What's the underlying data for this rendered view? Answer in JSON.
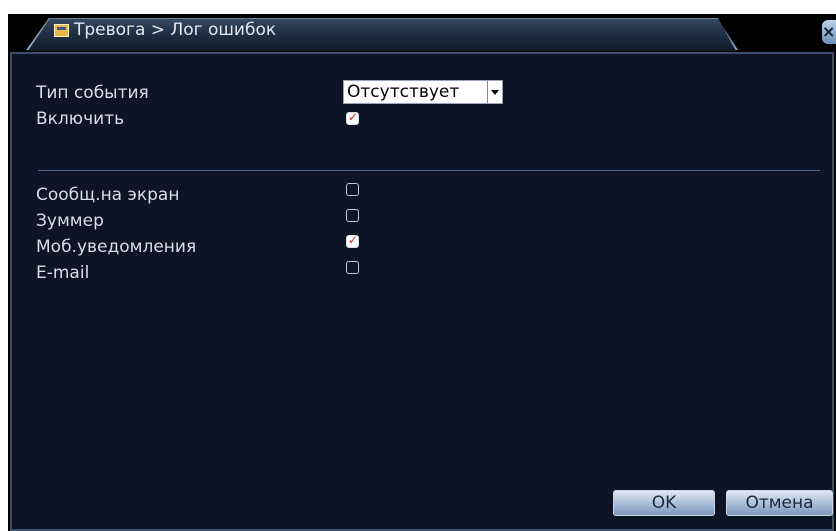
{
  "window": {
    "title": "Тревога > Лог ошибок",
    "close_symbol": "×"
  },
  "form": {
    "event_type_label": "Тип события",
    "event_type_value": "Отсутствует",
    "enable_label": "Включить",
    "enable_checked": true
  },
  "actions": [
    {
      "label": "Сообщ.на экран",
      "checked": false
    },
    {
      "label": "Зуммер",
      "checked": false
    },
    {
      "label": "Моб.уведомления",
      "checked": true
    },
    {
      "label": "E-mail",
      "checked": false
    }
  ],
  "buttons": {
    "ok": "OK",
    "cancel": "Отмена"
  },
  "icons": {
    "title": "window-icon",
    "close": "close-icon",
    "dropdown": "chevron-down-icon"
  },
  "colors": {
    "panel_bg": "#0c1425",
    "text": "#d9dee6",
    "check_mark": "#d42a2a",
    "button": "#a6bcd6"
  }
}
